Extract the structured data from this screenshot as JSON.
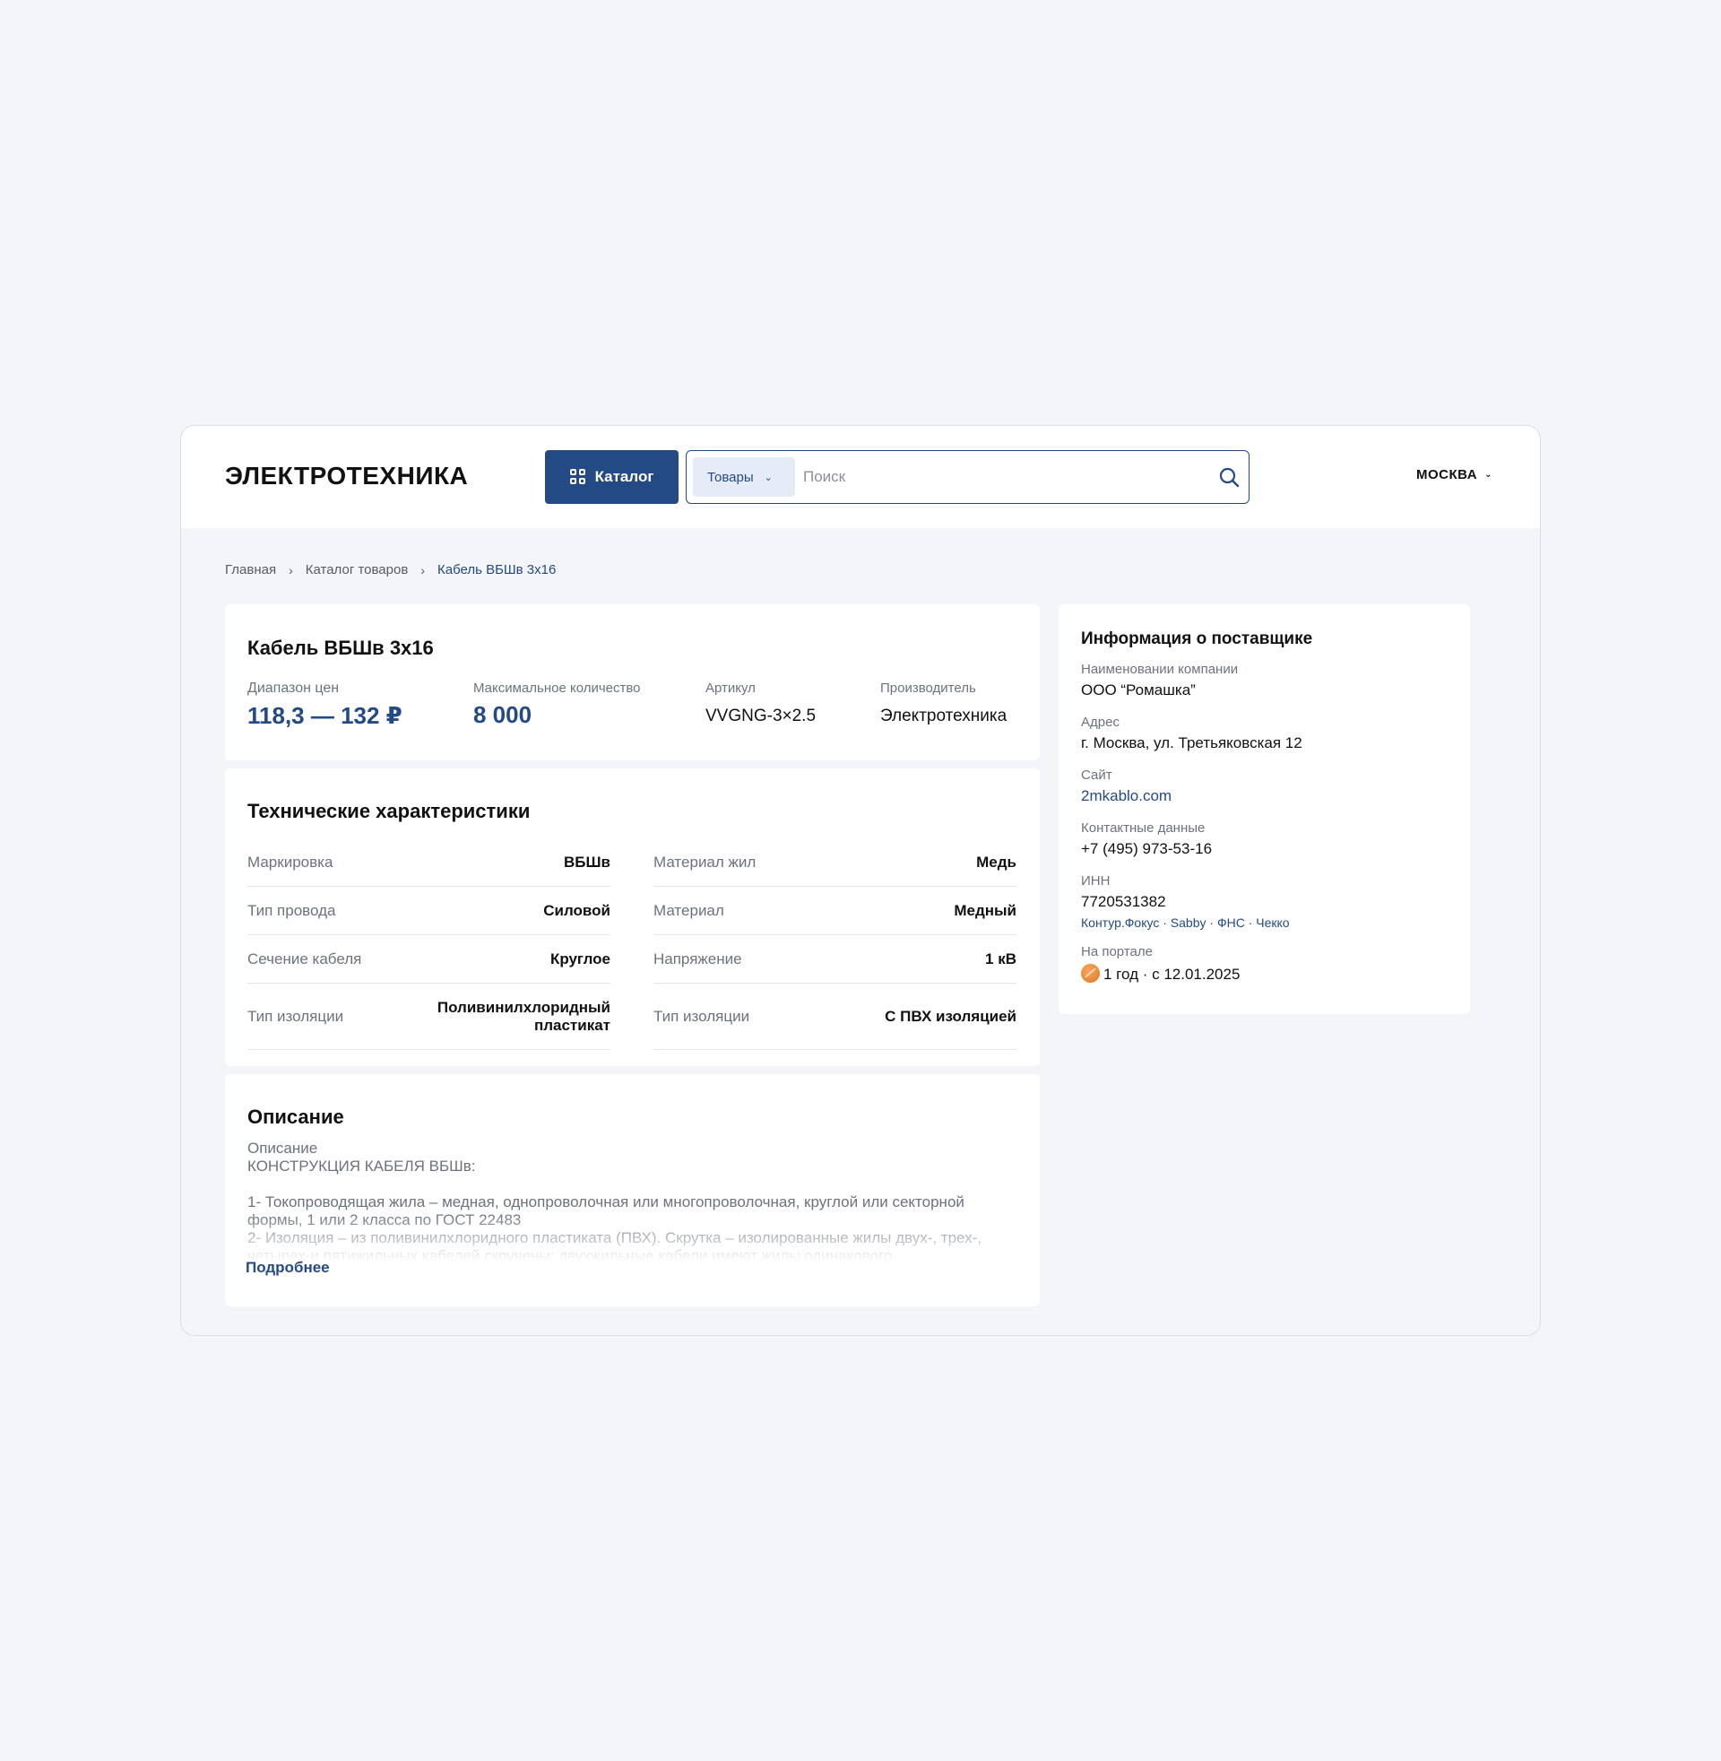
{
  "header": {
    "logo": "ЭЛЕКТРОТЕХНИКА",
    "catalog_button": "Каталог",
    "search_scope": "Товары",
    "search_placeholder": "Поиск",
    "city": "МОСКВА"
  },
  "breadcrumb": [
    "Главная",
    "Каталог товаров",
    "Кабель ВБШв 3х16"
  ],
  "product": {
    "title": "Кабель ВБШв 3х16",
    "price_label": "Диапазон цен",
    "price_value": "118,3 — 132 ₽",
    "qty_label": "Максимальное количество",
    "qty_value": "8 000",
    "sku_label": "Артикул",
    "sku_value": "VVGNG-3×2.5",
    "maker_label": "Производитель",
    "maker_value": "Электротехника"
  },
  "tech": {
    "title": "Технические характеристики",
    "left": [
      {
        "k": "Маркировка",
        "v": "ВБШв"
      },
      {
        "k": "Тип провода",
        "v": "Силовой"
      },
      {
        "k": "Сечение кабеля",
        "v": "Круглое"
      },
      {
        "k": "Тип изоляции",
        "v": "Поливинилхлоридный пластикат"
      }
    ],
    "right": [
      {
        "k": "Материал жил",
        "v": "Медь"
      },
      {
        "k": "Материал",
        "v": "Медный"
      },
      {
        "k": "Напряжение",
        "v": "1 кВ"
      },
      {
        "k": "Тип изоляции",
        "v": "С ПВХ изоляцией"
      }
    ]
  },
  "description": {
    "title": "Описание",
    "subtitle": "Описание",
    "heading": "КОНСТРУКЦИЯ КАБЕЛЯ ВБШв:",
    "p1": "1- Токопроводящая жила – медная, однопроволочная или многопроволочная, круглой или секторной формы, 1 или 2 класса по ГОСТ 22483",
    "p2": "2- Изоляция – из поливинилхлоридного пластиката (ПВХ). Скрутка – изолированные жилы двух-, трех-, четырех-и пятижильных кабелей скручены; двухжильные кабели имеют жилы одинакового",
    "more": "Подробнее"
  },
  "supplier": {
    "title": "Информация о поставщике",
    "company_label": "Наименовании компании",
    "company_value": "ООО “Ромашка”",
    "address_label": "Адрес",
    "address_value": "г. Москва, ул. Третьяковская 12",
    "site_label": "Сайт",
    "site_value": "2mkablo.com",
    "contacts_label": "Контактные данные",
    "contacts_value": "+7 (495) 973-53-16",
    "inn_label": "ИНН",
    "inn_value": "7720531382",
    "inn_links": [
      "Контур.Фокус",
      "Sabby",
      "ФНС",
      "Чекко"
    ],
    "portal_label": "На портале",
    "portal_value": "1 год · с 12.01.2025"
  },
  "icons": {
    "catalog": "grid-icon",
    "search": "search-icon",
    "chevron": "chevron-down-icon",
    "breadcrumb_sep": "chevron-right-icon",
    "portal": "medal-icon"
  },
  "colors": {
    "accent": "#244a86",
    "background": "#f3f5f9",
    "scope_bg": "#e5ecf8",
    "medal": "#e98a36"
  }
}
